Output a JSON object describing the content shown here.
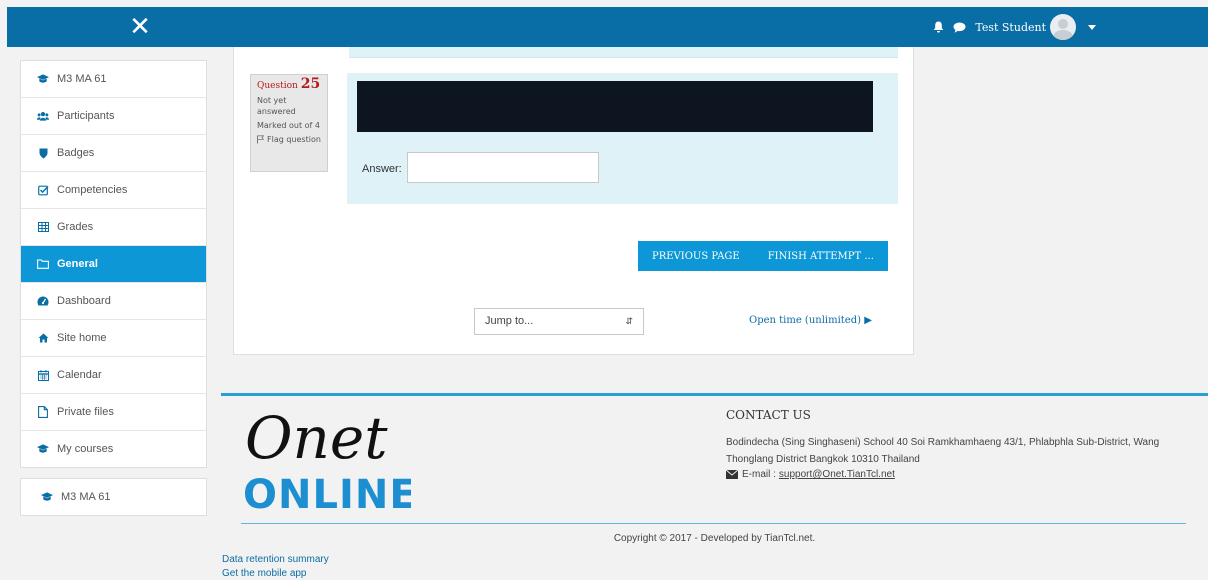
{
  "header": {
    "close_label": "✕",
    "user_name": "Test Student"
  },
  "sidebar": {
    "group1": [
      {
        "label": "M3 MA 61",
        "icon": "graduation-cap-icon"
      },
      {
        "label": "Participants",
        "icon": "users-icon"
      },
      {
        "label": "Badges",
        "icon": "shield-icon"
      },
      {
        "label": "Competencies",
        "icon": "check-square-icon"
      },
      {
        "label": "Grades",
        "icon": "table-icon"
      },
      {
        "label": "General",
        "icon": "folder-icon",
        "active": true
      },
      {
        "label": "Dashboard",
        "icon": "dashboard-icon"
      },
      {
        "label": "Site home",
        "icon": "home-icon"
      },
      {
        "label": "Calendar",
        "icon": "calendar-icon"
      },
      {
        "label": "Private files",
        "icon": "file-icon"
      },
      {
        "label": "My courses",
        "icon": "graduation-cap-icon"
      }
    ],
    "group2": [
      {
        "label": "M3 MA 61",
        "icon": "graduation-cap-icon"
      }
    ]
  },
  "question": {
    "label": "Question",
    "number": "25",
    "status": "Not yet answered",
    "marks": "Marked out of 4",
    "flag": "Flag question",
    "answer_label": "Answer:",
    "answer_value": ""
  },
  "nav": {
    "previous": "PREVIOUS PAGE",
    "finish": "FINISH ATTEMPT ...",
    "jump": "Jump to...",
    "open_time": "Open time (unlimited) ▶"
  },
  "footer": {
    "logo_top": "Onet",
    "logo_bottom": "ONLINE",
    "contact_heading": "CONTACT US",
    "address": "Bodindecha (Sing Singhaseni) School 40 Soi Ramkhamhaeng 43/1, Phlabphla Sub-District, Wang Thonglang District Bangkok 10310 Thailand",
    "email_label": "E-mail :",
    "email": "support@Onet.TianTcl.net",
    "copyright": "Copyright © 2017 - Developed by TianTcl.net."
  },
  "bottom_links": [
    "Data retention summary",
    "Get the mobile app"
  ],
  "colors": {
    "topbar": "#0a6ea6",
    "accent": "#0e97d6",
    "question_bg": "#def2f8"
  }
}
